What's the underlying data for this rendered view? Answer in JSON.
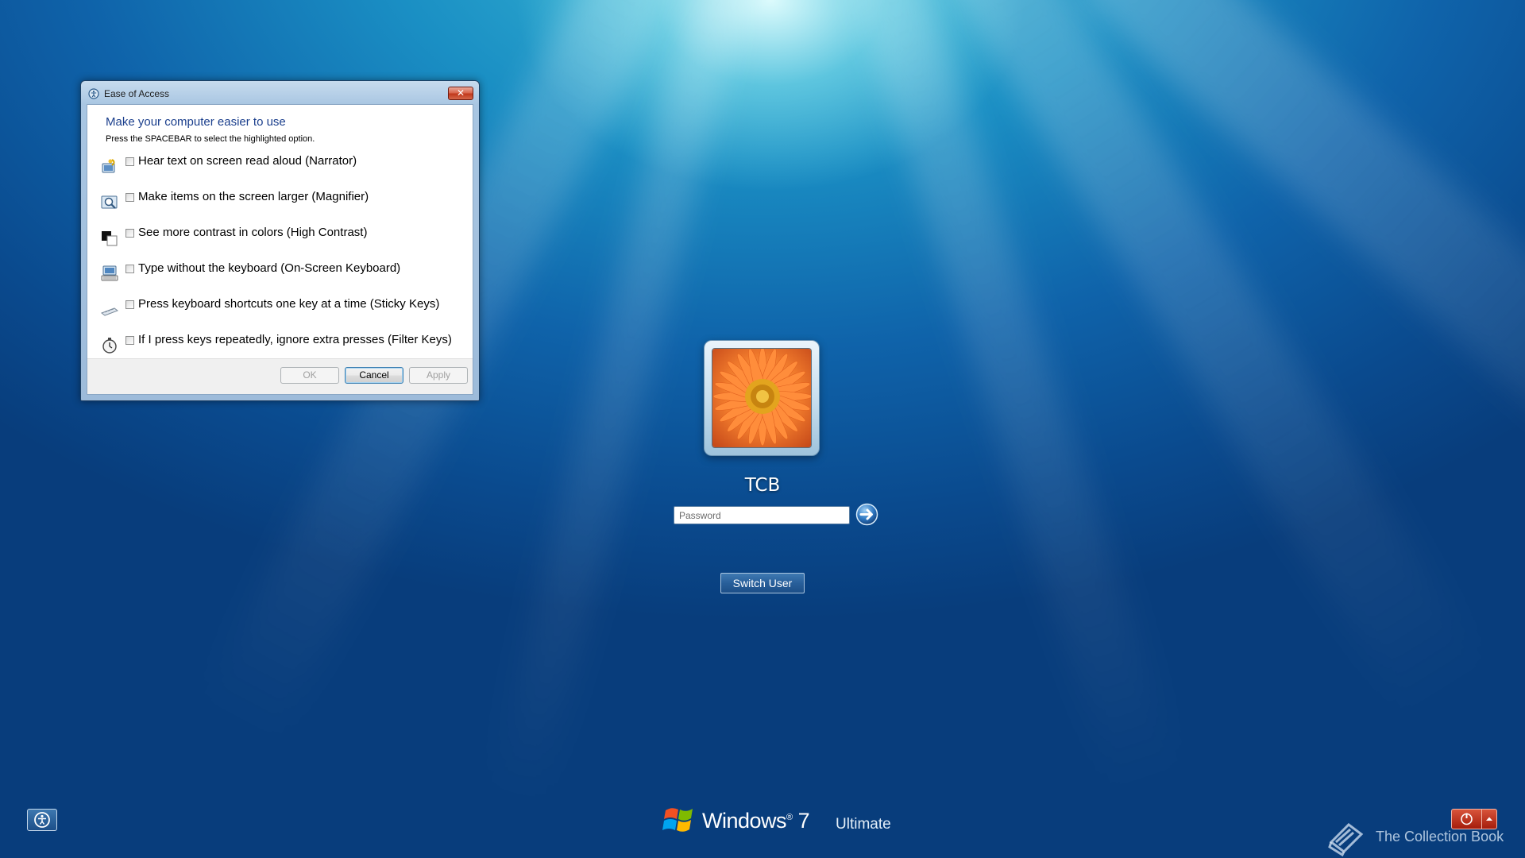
{
  "dialog": {
    "title": "Ease of Access",
    "close_label": "✕",
    "heading": "Make your computer easier to use",
    "instruction": "Press the SPACEBAR to select the highlighted option.",
    "options": [
      {
        "label": "Hear text on screen read aloud (Narrator)",
        "icon": "narrator-icon",
        "checked": false
      },
      {
        "label": "Make items on the screen larger (Magnifier)",
        "icon": "magnifier-icon",
        "checked": false
      },
      {
        "label": "See more contrast in colors (High Contrast)",
        "icon": "high-contrast-icon",
        "checked": false
      },
      {
        "label": "Type without the keyboard (On-Screen Keyboard)",
        "icon": "on-screen-keyboard-icon",
        "checked": false
      },
      {
        "label": "Press keyboard shortcuts one key at a time (Sticky Keys)",
        "icon": "sticky-keys-icon",
        "checked": false
      },
      {
        "label": "If I press keys repeatedly, ignore extra presses (Filter Keys)",
        "icon": "filter-keys-icon",
        "checked": false
      }
    ],
    "buttons": {
      "ok": "OK",
      "cancel": "Cancel",
      "apply": "Apply"
    }
  },
  "logon": {
    "username": "TCB",
    "password_placeholder": "Password",
    "switch_user": "Switch User"
  },
  "branding": {
    "windows": "Windows",
    "version": "7",
    "edition": "Ultimate"
  },
  "watermark": {
    "text": "The Collection Book"
  },
  "colors": {
    "background_top": "#3fc0d8",
    "background_bottom": "#083d7c",
    "dialog_heading": "#1a3e8c",
    "shutdown_red": "#c1391c"
  }
}
